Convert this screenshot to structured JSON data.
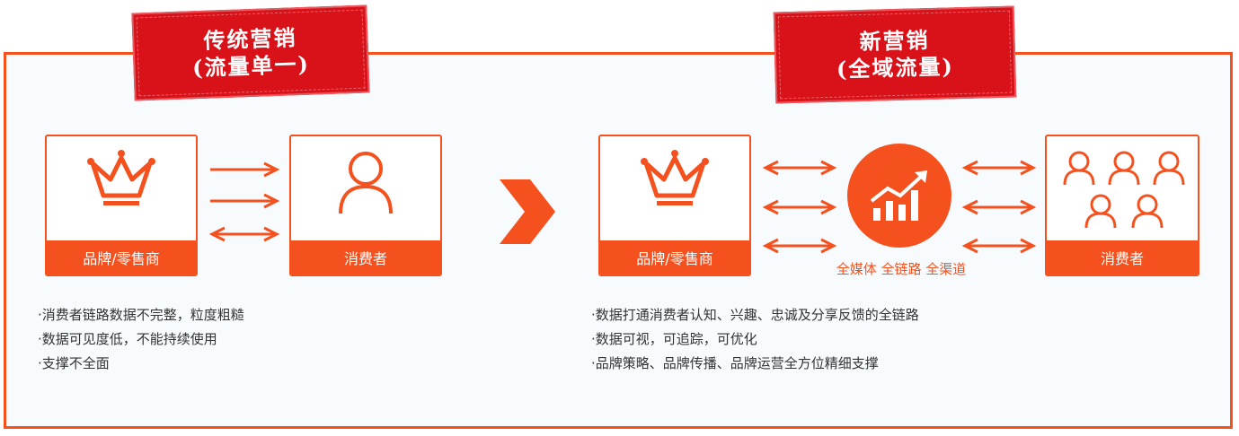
{
  "stamps": {
    "traditional": {
      "line1": "传统营销",
      "line2": "(流量单一)"
    },
    "new": {
      "line1": "新营销",
      "line2": "(全域流量)"
    }
  },
  "left": {
    "brand_label": "品牌/零售商",
    "consumer_label": "消费者",
    "bullets": [
      "·消费者链路数据不完整，粒度粗糙",
      "·数据可见度低，不能持续使用",
      "·支撑不全面"
    ]
  },
  "right": {
    "brand_label": "品牌/零售商",
    "consumer_label": "消费者",
    "caption": "全媒体 全链路 全渠道",
    "bullets": [
      "·数据打通消费者认知、兴趣、忠诚及分享反馈的全链路",
      "·数据可视，可追踪，可优化",
      "·品牌策略、品牌传播、品牌运营全方位精细支撑"
    ]
  },
  "colors": {
    "accent": "#f4511e",
    "stamp": "#d9121a"
  },
  "icons": [
    "crown-icon",
    "person-icon",
    "right-arrow-icon",
    "double-arrow-icon",
    "chevron-right-icon",
    "growth-chart-icon",
    "group-people-icon"
  ]
}
